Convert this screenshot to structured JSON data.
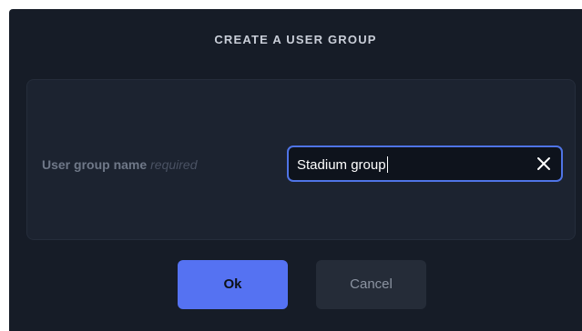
{
  "dialog": {
    "title": "CREATE A USER GROUP",
    "field": {
      "label": "User group name",
      "required_hint": "required",
      "value": "Stadium group"
    },
    "buttons": {
      "ok_label": "Ok",
      "cancel_label": "Cancel"
    }
  },
  "colors": {
    "dialog_bg": "#161c27",
    "panel_bg": "#1c2330",
    "accent": "#5572f2",
    "input_border": "#4f74e6"
  },
  "icons": {
    "clear": "close-icon"
  }
}
